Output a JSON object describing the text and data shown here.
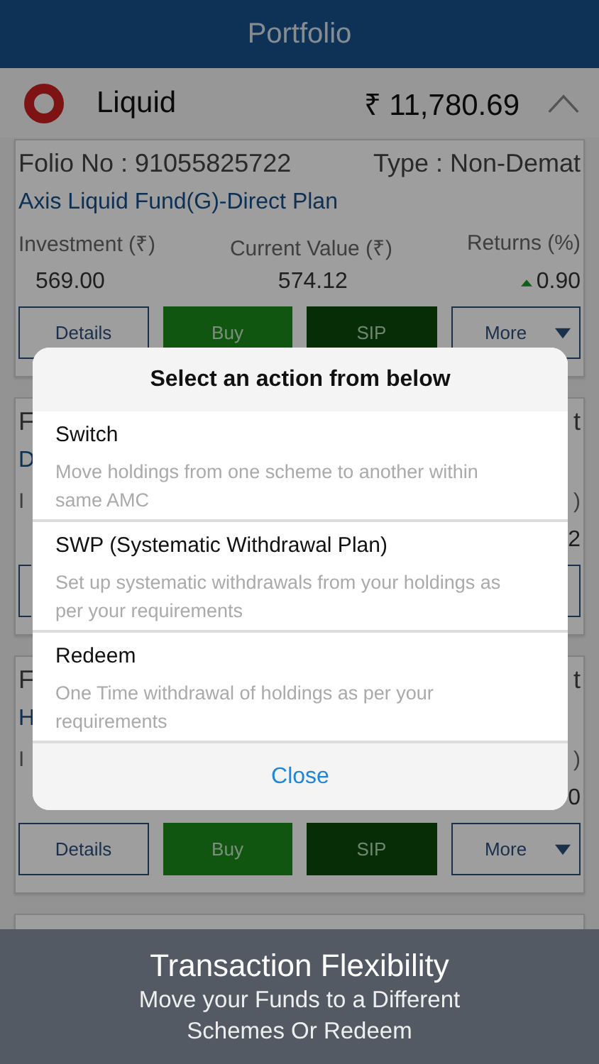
{
  "header": {
    "title": "Portfolio"
  },
  "category": {
    "name": "Liquid",
    "total": "₹ 11,780.69",
    "expanded": true
  },
  "cards": [
    {
      "kind": "fund",
      "folio": "Folio No : 91055825722",
      "type": "Type : Non-Demat",
      "fund": "Axis Liquid Fund(G)-Direct Plan",
      "investment_label": "Investment (₹)",
      "current_label": "Current Value (₹)",
      "returns_label": "Returns (%)",
      "investment": "569.00",
      "current": "574.12",
      "returns": "0.90",
      "returns_up": true,
      "buttons": [
        "Details",
        "Buy",
        "SIP",
        "More"
      ]
    },
    {
      "kind": "fund",
      "folio": "F",
      "type": "t",
      "fund": "D",
      "investment_label": "I",
      "returns_label": ")",
      "returns": "2"
    },
    {
      "kind": "fund",
      "folio": "F",
      "type": "t",
      "fund": "H",
      "investment_label": "I",
      "returns_label": ")",
      "returns": "0",
      "buttons": [
        "Details",
        "Buy",
        "SIP",
        "More"
      ]
    },
    {
      "kind": "peek"
    }
  ],
  "dialog": {
    "title": "Select an action from below",
    "actions": [
      {
        "name": "Switch",
        "description": "Move holdings from one scheme to another within same AMC"
      },
      {
        "name": "SWP (Systematic Withdrawal Plan)",
        "description": "Set up systematic withdrawals from your holdings as per your requirements"
      },
      {
        "name": "Redeem",
        "description": "One Time withdrawal of holdings as per your requirements"
      }
    ],
    "close": "Close"
  },
  "banner": {
    "title": "Transaction Flexibility",
    "subtitle": "Move your Funds to a Different Schemes Or Redeem"
  }
}
